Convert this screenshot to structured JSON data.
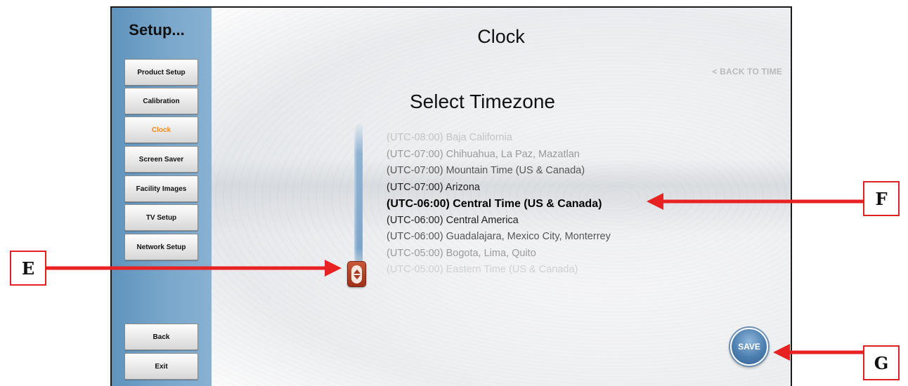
{
  "sidebar": {
    "title": "Setup...",
    "items": [
      {
        "label": "Product Setup"
      },
      {
        "label": "Calibration"
      },
      {
        "label": "Clock"
      },
      {
        "label": "Screen Saver"
      },
      {
        "label": "Facility Images"
      },
      {
        "label": "TV Setup"
      },
      {
        "label": "Network Setup"
      }
    ],
    "active_item": "Clock",
    "bottom_items": [
      {
        "label": "Back"
      },
      {
        "label": "Exit"
      }
    ]
  },
  "main": {
    "title": "Clock",
    "back_link": "< BACK TO TIME",
    "section_title": "Select Timezone",
    "timezones": [
      "(UTC-08:00) Baja California",
      "(UTC-07:00) Chihuahua, La Paz, Mazatlan",
      "(UTC-07:00) Mountain Time (US & Canada)",
      "(UTC-07:00) Arizona",
      "(UTC-06:00) Central Time (US & Canada)",
      "(UTC-06:00) Central America",
      "(UTC-06:00) Guadalajara, Mexico City, Monterrey",
      "(UTC-05:00) Bogota, Lima, Quito",
      "(UTC-05:00) Eastern Time (US & Canada)"
    ],
    "selected_timezone": "(UTC-06:00) Central Time (US & Canada)",
    "save_label": "SAVE"
  },
  "callouts": {
    "e": "E",
    "f": "F",
    "g": "G"
  },
  "colors": {
    "sidebar_blue": "#6f9fc6",
    "active_item": "#f08a1c",
    "scroll_handle": "#b8452b",
    "save_button": "#4c7fb0",
    "callout_red": "#e02020"
  },
  "icons": {
    "scroll_handle": "up-down-arrows-icon",
    "callout_arrow": "arrow-icon"
  }
}
